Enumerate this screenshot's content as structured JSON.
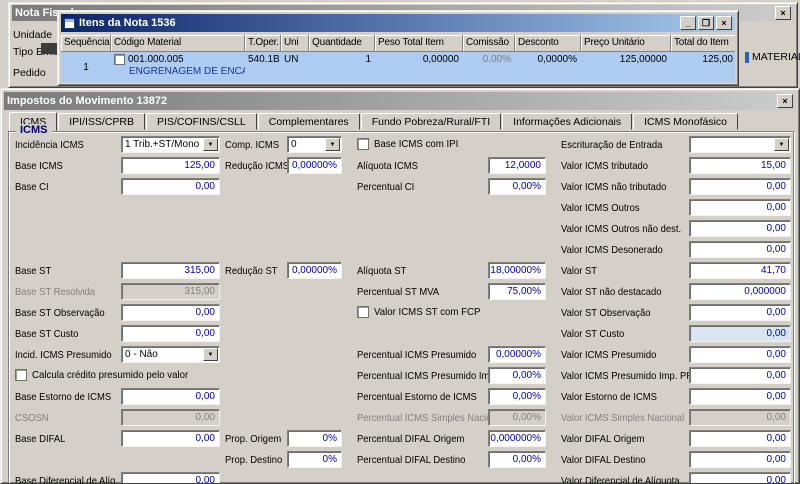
{
  "icons": {
    "close": "×",
    "minimize": "_",
    "maximize": "❐",
    "chevron_down": "▼"
  },
  "nota_fiscal": {
    "title": "Nota Fiscal",
    "labels": [
      "Unidade",
      "Tipo Emis",
      "Pedido"
    ],
    "material_text": "MATERIAL"
  },
  "items": {
    "title": "Itens da Nota 1536",
    "columns": [
      "Sequência",
      "Código Material",
      "T.Oper.",
      "Uni",
      "Quantidade",
      "Peso Total Item",
      "Comissão",
      "Desconto",
      "Preço Unitário",
      "Total do Item"
    ],
    "row": {
      "sequencia": "1",
      "codigo": "001.000.005",
      "descricao": "ENGRENAGEM DE ENCAIXE",
      "toper": "540.1B",
      "uni": "UN",
      "quantidade": "1",
      "peso_total": "0,00000",
      "comissao": "0,00%",
      "desconto": "0,0000%",
      "preco_unitario": "125,00000",
      "total_item": "125,00"
    }
  },
  "impostos": {
    "title": "Impostos do Movimento 13872",
    "tabs": [
      "ICMS",
      "IPI/ISS/CPRB",
      "PIS/COFINS/CSLL",
      "Complementares",
      "Fundo Pobreza/Rural/FTI",
      "Informações Adicionais",
      "ICMS Monofásico"
    ],
    "active_tab": "ICMS",
    "group_title": "ICMS",
    "fields": [
      {
        "name": "incidencia-icms",
        "label": "Incidência ICMS",
        "value": "1 Trib.+ST/Mono",
        "type": "select",
        "col": 1,
        "row": 1
      },
      {
        "name": "comp-icms",
        "label": "Comp. ICMS",
        "value": "0",
        "type": "select",
        "col": 2,
        "row": 1
      },
      {
        "name": "base-icms-com-ipi",
        "label": "Base ICMS com IPI",
        "type": "checkbox",
        "checked": false,
        "col": 3,
        "row": 1
      },
      {
        "name": "escrituracao-de-entrada",
        "label": "Escrituração de Entrada",
        "value": "",
        "type": "select",
        "col": 4,
        "row": 1
      },
      {
        "name": "base-icms",
        "label": "Base ICMS",
        "value": "125,00",
        "type": "input",
        "col": 1,
        "row": 2
      },
      {
        "name": "reducao-icms",
        "label": "Redução ICMS",
        "value": "0,00000%",
        "type": "input",
        "col": 2,
        "row": 2
      },
      {
        "name": "aliquota-icms",
        "label": "Alíquota ICMS",
        "value": "12,0000",
        "type": "input",
        "col": 3,
        "row": 2
      },
      {
        "name": "valor-icms-tributado",
        "label": "Valor ICMS tributado",
        "value": "15,00",
        "type": "input",
        "col": 4,
        "row": 2
      },
      {
        "name": "base-ci",
        "label": "Base CI",
        "value": "0,00",
        "type": "input",
        "col": 1,
        "row": 3
      },
      {
        "name": "percentual-ci",
        "label": "Percentual CI",
        "value": "0,00%",
        "type": "input",
        "col": 3,
        "row": 3
      },
      {
        "name": "valor-icms-nao-tributado",
        "label": "Valor ICMS não tributado",
        "value": "0,00",
        "type": "input",
        "col": 4,
        "row": 3
      },
      {
        "name": "valor-icms-outros",
        "label": "Valor ICMS Outros",
        "value": "0,00",
        "type": "input",
        "col": 4,
        "row": 4
      },
      {
        "name": "valor-icms-outros-nao-dest",
        "label": "Valor ICMS Outros não dest.",
        "value": "0,00",
        "type": "input",
        "col": 4,
        "row": 5
      },
      {
        "name": "valor-icms-desonerado",
        "label": "Valor ICMS Desonerado",
        "value": "0,00",
        "type": "input",
        "col": 4,
        "row": 6
      },
      {
        "name": "base-st",
        "label": "Base ST",
        "value": "315,00",
        "type": "input",
        "col": 1,
        "row": 7
      },
      {
        "name": "reducao-st",
        "label": "Redução ST",
        "value": "0,00000%",
        "type": "input",
        "col": 2,
        "row": 7
      },
      {
        "name": "aliquota-st",
        "label": "Alíquota ST",
        "value": "18,00000%",
        "type": "input",
        "col": 3,
        "row": 7
      },
      {
        "name": "valor-st",
        "label": "Valor ST",
        "value": "41,70",
        "type": "input",
        "col": 4,
        "row": 7
      },
      {
        "name": "base-st-resolvida",
        "label": "Base ST Resolvida",
        "value": "315,00",
        "type": "input",
        "col": 1,
        "row": 8,
        "state": "disabled"
      },
      {
        "name": "percentual-st-mva",
        "label": "Percentual ST MVA",
        "value": "75,00%",
        "type": "input",
        "col": 3,
        "row": 8
      },
      {
        "name": "valor-st-nao-destacado",
        "label": "Valor ST não destacado",
        "value": "0,000000",
        "type": "input",
        "col": 4,
        "row": 8
      },
      {
        "name": "base-st-observacao",
        "label": "Base ST Observação",
        "value": "0,00",
        "type": "input",
        "col": 1,
        "row": 9
      },
      {
        "name": "valor-icms-st-com-fcp",
        "label": "Valor ICMS ST com FCP",
        "type": "checkbox",
        "checked": false,
        "col": 3,
        "row": 9
      },
      {
        "name": "valor-st-observacao",
        "label": "Valor ST Observação",
        "value": "0,00",
        "type": "input",
        "col": 4,
        "row": 9
      },
      {
        "name": "base-st-custo",
        "label": "Base ST Custo",
        "value": "0,00",
        "type": "input",
        "col": 1,
        "row": 10
      },
      {
        "name": "valor-st-custo",
        "label": "Valor ST Custo",
        "value": "0,00",
        "type": "input",
        "col": 4,
        "row": 10,
        "state": "highlight"
      },
      {
        "name": "incid-icms-presumido",
        "label": "Incid. ICMS Presumido",
        "value": "0 - Não",
        "type": "select",
        "col": 1,
        "row": 11
      },
      {
        "name": "percentual-icms-presumido",
        "label": "Percentual ICMS Presumido",
        "value": "0,00000%",
        "type": "input",
        "col": 3,
        "row": 11
      },
      {
        "name": "valor-icms-presumido",
        "label": "Valor ICMS Presumido",
        "value": "0,00",
        "type": "input",
        "col": 4,
        "row": 11
      },
      {
        "name": "calcula-credito-presumido",
        "label": "Calcula crédito presumido pelo valor",
        "type": "checkbox",
        "checked": false,
        "col": 1,
        "row": 12
      },
      {
        "name": "percentual-icms-presumido-imp-pr",
        "label": "Percentual ICMS Presumido Imp. PR",
        "value": "0,00%",
        "type": "input",
        "col": 3,
        "row": 12
      },
      {
        "name": "valor-icms-presumido-imp-pr",
        "label": "Valor ICMS Presumido Imp. PR",
        "value": "0,00",
        "type": "input",
        "col": 4,
        "row": 12
      },
      {
        "name": "base-estorno-de-icms",
        "label": "Base Estorno de ICMS",
        "value": "0,00",
        "type": "input",
        "col": 1,
        "row": 13
      },
      {
        "name": "percentual-estorno-de-icms",
        "label": "Percentual Estorno de ICMS",
        "value": "0,00%",
        "type": "input",
        "col": 3,
        "row": 13
      },
      {
        "name": "valor-estorno-de-icms",
        "label": "Valor Estorno de ICMS",
        "value": "0,00",
        "type": "input",
        "col": 4,
        "row": 13
      },
      {
        "name": "csosn",
        "label": "CSOSN",
        "value": "0,00",
        "type": "input",
        "col": 1,
        "row": 14,
        "state": "disabled"
      },
      {
        "name": "percentual-icms-simples-nacional",
        "label": "Percentual ICMS Simples Nacional",
        "value": "0,00%",
        "type": "input",
        "col": 3,
        "row": 14,
        "state": "disabled"
      },
      {
        "name": "valor-icms-simples-nacional",
        "label": "Valor ICMS Simples Nacional",
        "value": "0,00",
        "type": "input",
        "col": 4,
        "row": 14,
        "state": "disabled"
      },
      {
        "name": "base-difal",
        "label": "Base DIFAL",
        "value": "0,00",
        "type": "input",
        "col": 1,
        "row": 15
      },
      {
        "name": "prop-origem",
        "label": "Prop. Origem",
        "value": "0%",
        "type": "input",
        "col": 2,
        "row": 15
      },
      {
        "name": "percentual-difal-origem",
        "label": "Percentual DIFAL Origem",
        "value": "0,000000%",
        "type": "input",
        "col": 3,
        "row": 15
      },
      {
        "name": "valor-difal-origem",
        "label": "Valor DIFAL Origem",
        "value": "0,00",
        "type": "input",
        "col": 4,
        "row": 15
      },
      {
        "name": "prop-destino",
        "label": "Prop. Destino",
        "value": "0%",
        "type": "input",
        "col": 2,
        "row": 16
      },
      {
        "name": "percentual-difal-destino",
        "label": "Percentual DIFAL Destino",
        "value": "0,00%",
        "type": "input",
        "col": 3,
        "row": 16
      },
      {
        "name": "valor-difal-destino",
        "label": "Valor DIFAL Destino",
        "value": "0,00",
        "type": "input",
        "col": 4,
        "row": 16
      },
      {
        "name": "base-diferencial-de-aliq",
        "label": "Base Diferencial de Alíq.",
        "value": "0,00",
        "type": "input",
        "col": 1,
        "row": 17
      },
      {
        "name": "valor-diferencial-de-aliquota",
        "label": "Valor Diferencial de Alíquota",
        "value": "0,00",
        "type": "input",
        "col": 4,
        "row": 17
      }
    ]
  }
}
